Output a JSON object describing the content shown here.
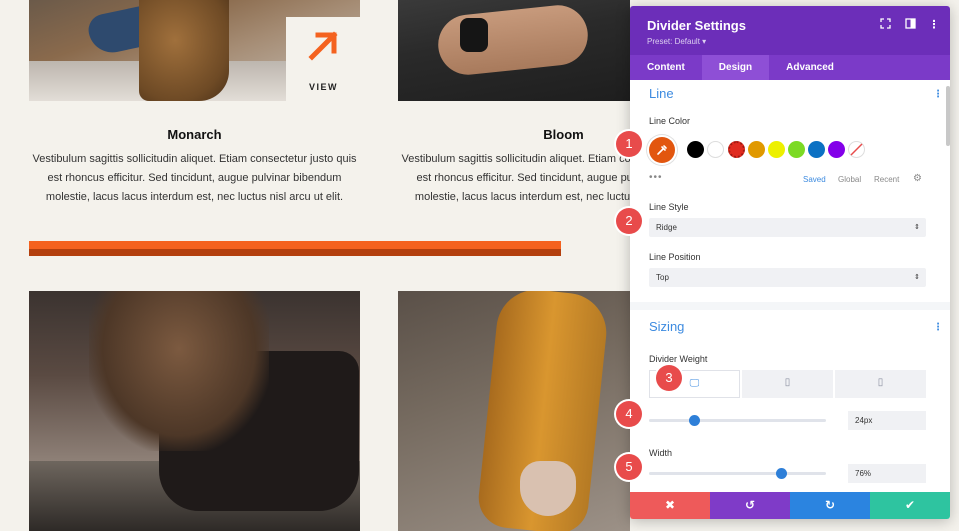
{
  "page": {
    "view_label": "VIEW",
    "cards": [
      {
        "title": "Monarch",
        "text": "Vestibulum sagittis sollicitudin aliquet. Etiam consectetur justo quis est rhoncus efficitur. Sed tincidunt, augue pulvinar bibendum molestie, lacus lacus interdum est, nec luctus nisl arcu ut elit."
      },
      {
        "title": "Bloom",
        "text": "Vestibulum sagittis sollicitudin aliquet. Etiam consectetur justo quis est rhoncus efficitur. Sed tincidunt, augue pulvinar bibendum molestie, lacus lacus interdum est, nec luctus nisl arcu ut elit."
      }
    ],
    "divider_colors": {
      "top": "#f4621f",
      "bottom": "#b3400e"
    }
  },
  "panel": {
    "title": "Divider Settings",
    "preset": "Preset: Default ▾",
    "tabs": [
      "Content",
      "Design",
      "Advanced"
    ],
    "active_tab": "Design",
    "line_section": {
      "heading": "Line",
      "line_color_label": "Line Color",
      "selected_color": "#e2560f",
      "swatches": [
        "#000000",
        "#ffffff",
        "#e02b20",
        "#e09900",
        "#edf000",
        "#7cda24",
        "#0c71c3",
        "#8300e9"
      ],
      "color_tabs": {
        "saved": "Saved",
        "global": "Global",
        "recent": "Recent"
      },
      "line_style_label": "Line Style",
      "line_style_value": "Ridge",
      "line_position_label": "Line Position",
      "line_position_value": "Top"
    },
    "sizing_section": {
      "heading": "Sizing",
      "divider_weight_label": "Divider Weight",
      "devices": [
        "desktop",
        "tablet",
        "phone"
      ],
      "weight_value": "24px",
      "width_label": "Width",
      "width_value": "76%"
    },
    "footer": {
      "cancel": "✖",
      "undo": "↺",
      "redo": "↻",
      "save": "✔"
    }
  },
  "markers": [
    "1",
    "2",
    "3",
    "4",
    "5"
  ],
  "colors": {
    "accent_purple": "#6c2eb9",
    "accent_blue": "#3d8be0",
    "marker_red": "#e84b4b",
    "brand_orange": "#f4621f"
  }
}
